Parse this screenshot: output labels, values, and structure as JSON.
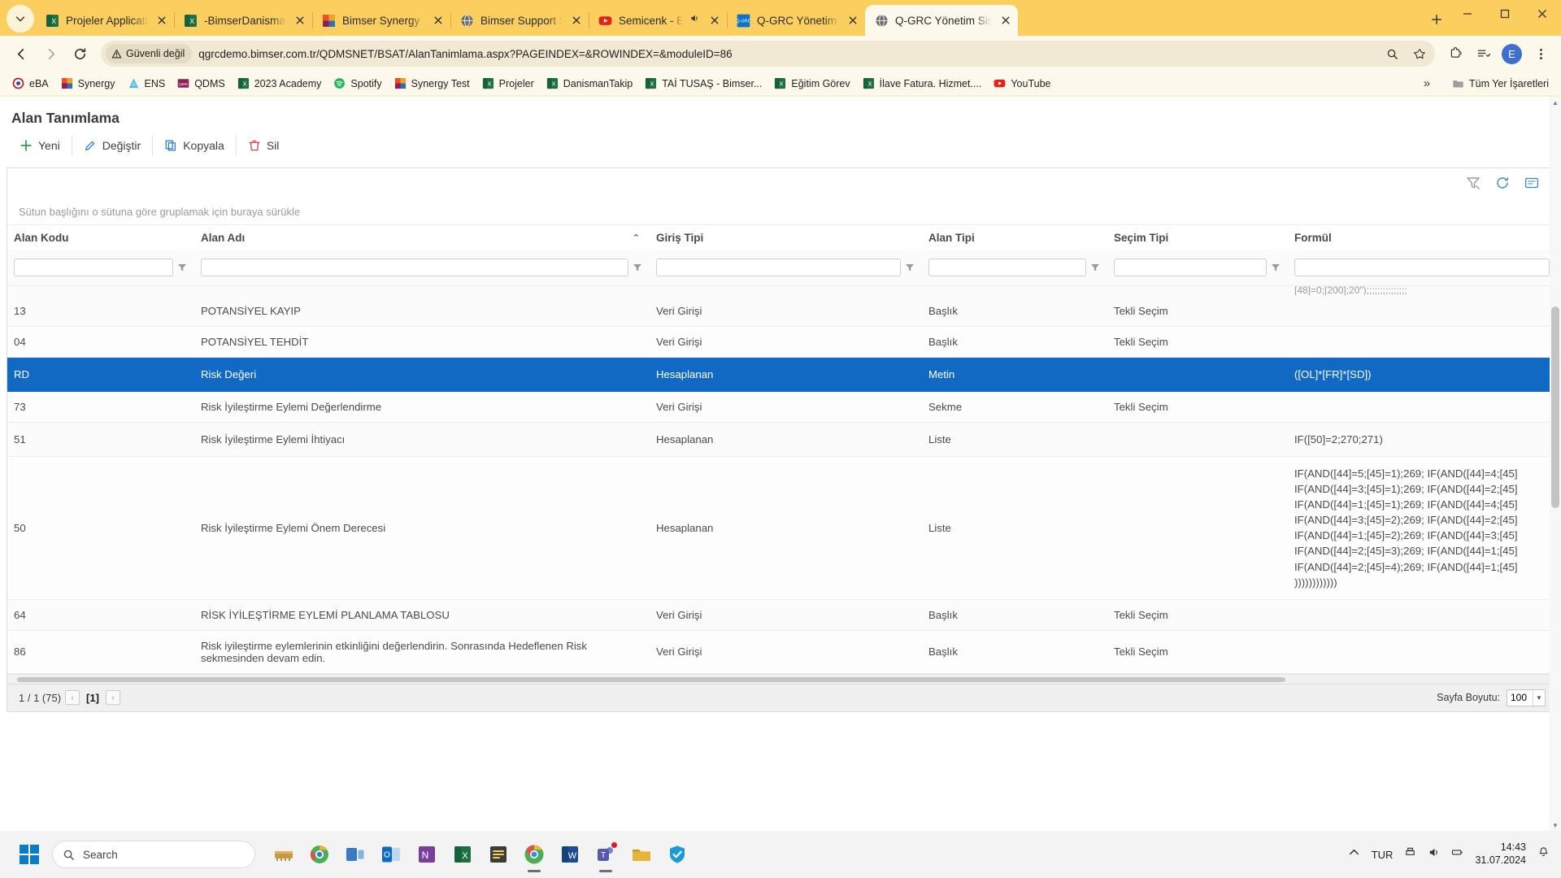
{
  "browser": {
    "tab_list_icon": "chevron-down-icon",
    "tabs": [
      {
        "title": "Projeler Applications",
        "favicon": "excel-icon",
        "active": false,
        "audio": false
      },
      {
        "title": "-BimserDanismanTak...",
        "favicon": "excel-icon",
        "active": false,
        "audio": false
      },
      {
        "title": "Bimser Synergy",
        "favicon": "synergy-icon",
        "active": false,
        "audio": false
      },
      {
        "title": "Bimser Support Syste...",
        "favicon": "globe-icon",
        "active": false,
        "audio": false
      },
      {
        "title": "Semicenk - Batık",
        "favicon": "youtube-icon",
        "active": false,
        "audio": true
      },
      {
        "title": "Q-GRC Yönetim Siste...",
        "favicon": "qgrc-icon",
        "active": false,
        "audio": false
      },
      {
        "title": "Q-GRC Yönetim Siste...",
        "favicon": "globe-icon",
        "active": true,
        "audio": false
      }
    ],
    "new_tab_label": "+",
    "window_controls": [
      "minimize",
      "maximize",
      "close"
    ],
    "nav": {
      "back": "back-arrow",
      "forward": "forward-arrow",
      "reload": "reload-icon"
    },
    "security_label": "Güvenli değil",
    "url": "qgrcdemo.bimser.com.tr/QDMSNET/BSAT/AlanTanimlama.aspx?PAGEINDEX=&ROWINDEX=&moduleID=86",
    "omnibox_icons": [
      "zoom-search-icon",
      "bookmark-star-icon"
    ],
    "toolbar_icons": [
      "extensions-icon",
      "reading-list-icon",
      "menu-kebab-icon"
    ],
    "profile_initial": "E",
    "bookmarks": [
      {
        "label": "eBA",
        "icon": "eba-icon"
      },
      {
        "label": "Synergy",
        "icon": "synergy-icon"
      },
      {
        "label": "ENS",
        "icon": "ens-icon"
      },
      {
        "label": "QDMS",
        "icon": "qdms-icon"
      },
      {
        "label": "2023 Academy",
        "icon": "excel-icon"
      },
      {
        "label": "Spotify",
        "icon": "spotify-icon"
      },
      {
        "label": "Synergy Test",
        "icon": "synergy-icon"
      },
      {
        "label": "Projeler",
        "icon": "excel-icon"
      },
      {
        "label": "DanismanTakip",
        "icon": "excel-icon"
      },
      {
        "label": "TAİ TUSAŞ - Bimser...",
        "icon": "excel-icon"
      },
      {
        "label": "Eğitim Görev",
        "icon": "excel-icon"
      },
      {
        "label": "İlave Fatura. Hizmet....",
        "icon": "excel-icon"
      },
      {
        "label": "YouTube",
        "icon": "youtube-icon"
      }
    ],
    "bookmarks_overflow": "»",
    "all_bookmarks_label": "Tüm Yer İşaretleri",
    "all_bookmarks_icon": "folder-icon"
  },
  "page": {
    "title": "Alan Tanımlama",
    "commands": [
      {
        "label": "Yeni",
        "icon": "plus-icon"
      },
      {
        "label": "Değiştir",
        "icon": "pencil-icon"
      },
      {
        "label": "Kopyala",
        "icon": "copy-icon"
      },
      {
        "label": "Sil",
        "icon": "trash-icon"
      }
    ],
    "grid_tool_icons": [
      "clear-filter-icon",
      "refresh-icon",
      "export-icon"
    ],
    "group_hint": "Sütun başlığını o sütuna göre gruplamak için buraya sürükle",
    "columns": [
      {
        "key": "alan_kodu",
        "label": "Alan Kodu",
        "sorted": false
      },
      {
        "key": "alan_adi",
        "label": "Alan Adı",
        "sorted": true,
        "sort_caret": "⌃"
      },
      {
        "key": "giris_tipi",
        "label": "Giriş Tipi",
        "sorted": false
      },
      {
        "key": "alan_tipi",
        "label": "Alan Tipi",
        "sorted": false
      },
      {
        "key": "secim_tipi",
        "label": "Seçim Tipi",
        "sorted": false
      },
      {
        "key": "formul",
        "label": "Formül",
        "sorted": false
      }
    ],
    "filter_values": {
      "alan_kodu": "",
      "alan_adi": "",
      "giris_tipi": "",
      "alan_tipi": "",
      "secim_tipi": "",
      "formul": ""
    },
    "clipped_top_text": "[48]=0;[200];20\");;;;;;;;;;;;;;;",
    "rows": [
      {
        "alan_kodu": "13",
        "alan_adi": "POTANSİYEL KAYIP",
        "giris_tipi": "Veri Girişi",
        "alan_tipi": "Başlık",
        "secim_tipi": "Tekli Seçim",
        "formul": "",
        "selected": false
      },
      {
        "alan_kodu": "04",
        "alan_adi": "POTANSİYEL TEHDİT",
        "giris_tipi": "Veri Girişi",
        "alan_tipi": "Başlık",
        "secim_tipi": "Tekli Seçim",
        "formul": "",
        "selected": false
      },
      {
        "alan_kodu": "RD",
        "alan_adi": "Risk Değeri",
        "giris_tipi": "Hesaplanan",
        "alan_tipi": "Metin",
        "secim_tipi": "",
        "formul": "([OL]*[FR]*[SD])",
        "selected": true
      },
      {
        "alan_kodu": "73",
        "alan_adi": "Risk İyileştirme Eylemi Değerlendirme",
        "giris_tipi": "Veri Girişi",
        "alan_tipi": "Sekme",
        "secim_tipi": "Tekli Seçim",
        "formul": "",
        "selected": false
      },
      {
        "alan_kodu": "51",
        "alan_adi": "Risk İyileştirme Eylemi İhtiyacı",
        "giris_tipi": "Hesaplanan",
        "alan_tipi": "Liste",
        "secim_tipi": "",
        "formul": "IF([50]=2;270;271)",
        "selected": false
      },
      {
        "alan_kodu": "50",
        "alan_adi": "Risk İyileştirme Eylemi Önem Derecesi",
        "giris_tipi": "Hesaplanan",
        "alan_tipi": "Liste",
        "secim_tipi": "",
        "formul": "IF(AND([44]=5;[45]=1);269; IF(AND([44]=4;[45]\nIF(AND([44]=3;[45]=1);269; IF(AND([44]=2;[45]\nIF(AND([44]=1;[45]=1);269; IF(AND([44]=4;[45]\nIF(AND([44]=3;[45]=2);269; IF(AND([44]=2;[45]\nIF(AND([44]=1;[45]=2);269; IF(AND([44]=3;[45]\nIF(AND([44]=2;[45]=3);269; IF(AND([44]=1;[45]\nIF(AND([44]=2;[45]=4);269; IF(AND([44]=1;[45]\n))))))))))))",
        "selected": false
      },
      {
        "alan_kodu": "64",
        "alan_adi": "RİSK İYİLEŞTİRME EYLEMİ PLANLAMA TABLOSU",
        "giris_tipi": "Veri Girişi",
        "alan_tipi": "Başlık",
        "secim_tipi": "Tekli Seçim",
        "formul": "",
        "selected": false
      },
      {
        "alan_kodu": "86",
        "alan_adi": "Risk iyileştirme eylemlerinin etkinliğini değerlendirin. Sonrasında Hedeflenen Risk sekmesinden devam edin.",
        "giris_tipi": "Veri Girişi",
        "alan_tipi": "Başlık",
        "secim_tipi": "Tekli Seçim",
        "formul": "",
        "selected": false
      }
    ],
    "pager": {
      "summary": "1 / 1 (75)",
      "prev": "‹",
      "current_page": "[1]",
      "next": "›",
      "page_size_label": "Sayfa Boyutu:",
      "page_size_value": "100"
    }
  },
  "taskbar": {
    "start_icon": "windows-logo",
    "search_placeholder": "Search",
    "search_icon": "search-icon",
    "apps": [
      {
        "name": "widgets-icon",
        "label": "",
        "color": "#c7984a",
        "running": false,
        "badge": false
      },
      {
        "name": "chrome-dev-icon",
        "label": "",
        "color": "#f2b33d",
        "running": false,
        "badge": false
      },
      {
        "name": "task-view-icon",
        "label": "",
        "color": "#3b78c7",
        "running": false,
        "badge": false
      },
      {
        "name": "outlook-icon",
        "label": "O",
        "color": "#0f6cbd",
        "running": false,
        "badge": false
      },
      {
        "name": "onenote-icon",
        "label": "N",
        "color": "#7a3f9d",
        "running": false,
        "badge": false
      },
      {
        "name": "excel-icon",
        "label": "X",
        "color": "#1d7044",
        "running": false,
        "badge": false
      },
      {
        "name": "sticky-notes-icon",
        "label": "",
        "color": "#3c3c3c",
        "running": false,
        "badge": false
      },
      {
        "name": "chrome-icon",
        "label": "",
        "color": "#4285f4",
        "running": true,
        "badge": false
      },
      {
        "name": "word-icon",
        "label": "W",
        "color": "#1b4f91",
        "running": false,
        "badge": false
      },
      {
        "name": "teams-icon",
        "label": "T",
        "color": "#5558af",
        "running": true,
        "badge": true
      },
      {
        "name": "file-explorer-icon",
        "label": "",
        "color": "#e8b339",
        "running": false,
        "badge": false
      },
      {
        "name": "security-icon",
        "label": "",
        "color": "#1b9ad6",
        "running": false,
        "badge": false
      }
    ],
    "tray": {
      "overflow_icon": "chevron-up-icon",
      "language": "TUR",
      "icons": [
        "printer-icon",
        "volume-icon",
        "battery-icon"
      ],
      "time": "14:43",
      "date": "31.07.2024",
      "notification_icon": "bell-icon"
    }
  },
  "colors": {
    "tab_strip": "#fbcf5f",
    "toolbar": "#fdf8ec",
    "selected_row": "#1269c4",
    "accent": "#1269c4"
  }
}
